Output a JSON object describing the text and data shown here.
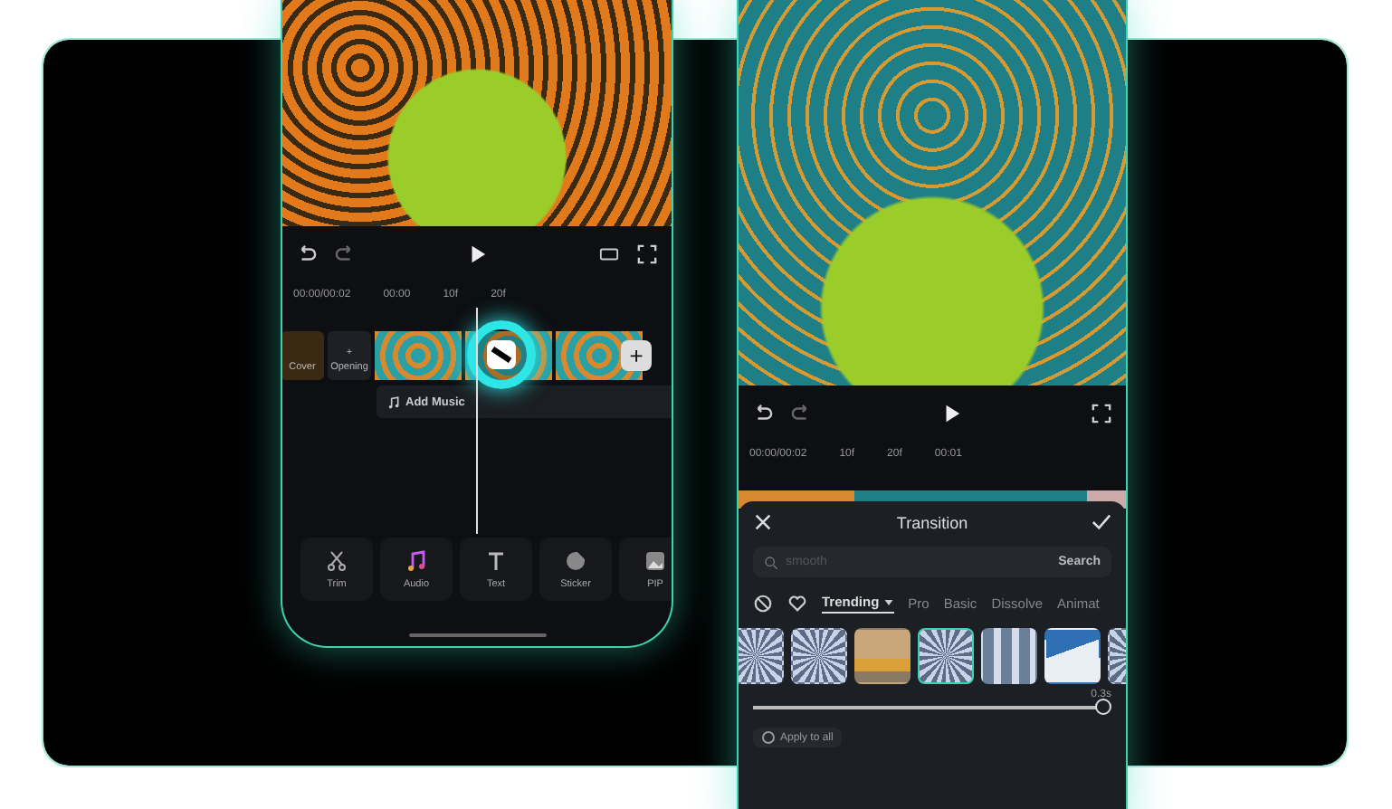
{
  "editor_phone": {
    "timeline": {
      "time": "00:00/00:02",
      "ticks": [
        "00:00",
        "10f",
        "20f"
      ]
    },
    "clips": [
      {
        "kind": "cover",
        "label": "Cover"
      },
      {
        "kind": "opening",
        "label": "Opening",
        "icon": "+"
      },
      {
        "kind": "video"
      },
      {
        "kind": "video"
      },
      {
        "kind": "video"
      }
    ],
    "add_clip": "+",
    "music_track": "Add Music",
    "tools": [
      {
        "kind": "trim",
        "label": "Trim"
      },
      {
        "kind": "audio",
        "label": "Audio"
      },
      {
        "kind": "text",
        "label": "Text"
      },
      {
        "kind": "sticker",
        "label": "Sticker"
      },
      {
        "kind": "pip",
        "label": "PIP"
      }
    ]
  },
  "transition_phone": {
    "timeline": {
      "time": "00:00/00:02",
      "ticks": [
        "10f",
        "20f",
        "00:01"
      ]
    },
    "panel": {
      "title": "Transition",
      "search": {
        "placeholder": "smooth",
        "button": "Search"
      },
      "tabs": [
        {
          "label": "Trending",
          "selected": true,
          "dropdown": true
        },
        {
          "label": "Pro",
          "selected": false
        },
        {
          "label": "Basic",
          "selected": false
        },
        {
          "label": "Dissolve",
          "selected": false
        },
        {
          "label": "Animat",
          "selected": false
        }
      ],
      "thumbnails": [
        {
          "kind": "burst",
          "selected": false
        },
        {
          "kind": "burst",
          "selected": false
        },
        {
          "kind": "van",
          "selected": false
        },
        {
          "kind": "burst",
          "selected": true
        },
        {
          "kind": "city",
          "selected": false
        },
        {
          "kind": "snow",
          "selected": false
        },
        {
          "kind": "burst",
          "selected": false
        }
      ],
      "duration": {
        "reading": "0.3s",
        "level": 1
      },
      "apply_to_all": {
        "label": "Apply to all",
        "checked": false
      }
    }
  }
}
